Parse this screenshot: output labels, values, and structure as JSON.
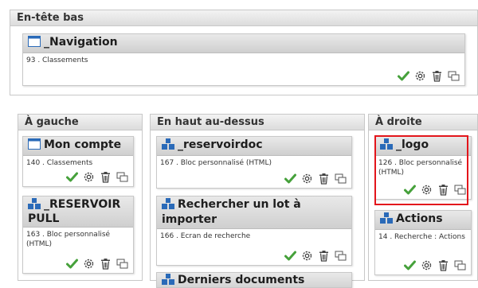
{
  "regions": {
    "bas": "En-tête bas",
    "gauche": "À gauche",
    "haut": "En haut au-dessus",
    "droite": "À droite"
  },
  "blocks": {
    "navigation": {
      "title": "_Navigation",
      "subtitle": "93 . Classements"
    },
    "mon_compte": {
      "title": "Mon compte",
      "subtitle": "140 . Classements"
    },
    "reservoir_pull": {
      "title_line1": "_RESERVOIR",
      "title_line2": "PULL",
      "subtitle": "163 . Bloc personnalisé (HTML)"
    },
    "reservoirdoc": {
      "title": "_reservoirdoc",
      "subtitle": "167 . Bloc personnalisé (HTML)"
    },
    "rechercher_lot": {
      "title": "Rechercher un lot à importer",
      "subtitle": "166 . Ecran de recherche"
    },
    "derniers_docs": {
      "title": "Derniers documents"
    },
    "logo": {
      "title": "_logo",
      "subtitle": "126 . Bloc personnalisé (HTML)"
    },
    "actions": {
      "title": "Actions",
      "subtitle": "14 . Recherche : Actions"
    }
  },
  "icons": {
    "check": "check-icon",
    "gear": "gear-icon",
    "trash": "trash-icon",
    "copy": "copy-icon",
    "window": "window-icon",
    "modules": "modules-icon"
  },
  "colors": {
    "check": "#46a13b",
    "highlight": "#e3151b",
    "block_icon": "#2a6ab8"
  }
}
